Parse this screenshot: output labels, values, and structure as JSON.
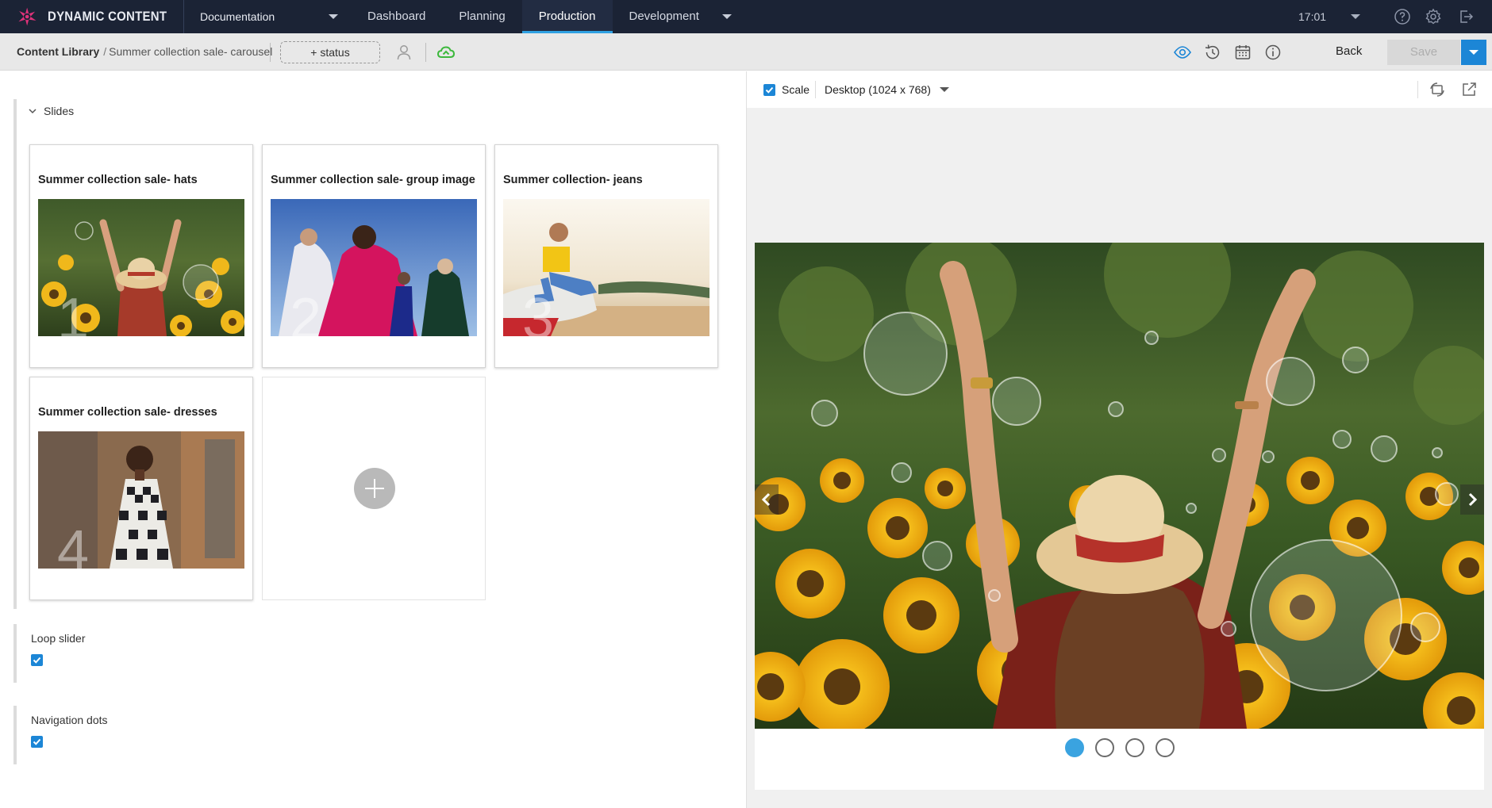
{
  "app": {
    "brand": "DYNAMIC CONTENT",
    "hub": "Documentation",
    "nav_tabs": [
      {
        "label": "Dashboard"
      },
      {
        "label": "Planning"
      },
      {
        "label": "Production",
        "active": true
      },
      {
        "label": "Development"
      }
    ],
    "time": "17:01"
  },
  "toolbar": {
    "breadcrumb_root": "Content Library",
    "breadcrumb_separator": "/",
    "breadcrumb_current": "Summer collection sale- carousel",
    "status_button": "+ status",
    "back_label": "Back",
    "save_label": "Save"
  },
  "editor": {
    "slides_label": "Slides",
    "slides": [
      {
        "title": "Summer collection sale- hats",
        "number": "1",
        "image": "woman-in-sunflower-field"
      },
      {
        "title": "Summer collection sale- group image",
        "number": "2",
        "image": "group-in-colorful-capes"
      },
      {
        "title": "Summer collection- jeans",
        "number": "3",
        "image": "woman-sitting-on-car"
      },
      {
        "title": "Summer collection sale- dresses",
        "number": "4",
        "image": "woman-in-gingham-dress"
      }
    ],
    "loop_slider": {
      "label": "Loop slider",
      "checked": true
    },
    "navigation_dots": {
      "label": "Navigation dots",
      "checked": true
    }
  },
  "preview": {
    "scale_label": "Scale",
    "scale_checked": true,
    "device": "Desktop (1024 x 768)",
    "current_slide": 1,
    "slide_count": 4
  },
  "colors": {
    "topbar": "#1b2335",
    "accent": "#1c86d6",
    "dot_active": "#3aa3e0",
    "cloud_green": "#3cb83c"
  }
}
